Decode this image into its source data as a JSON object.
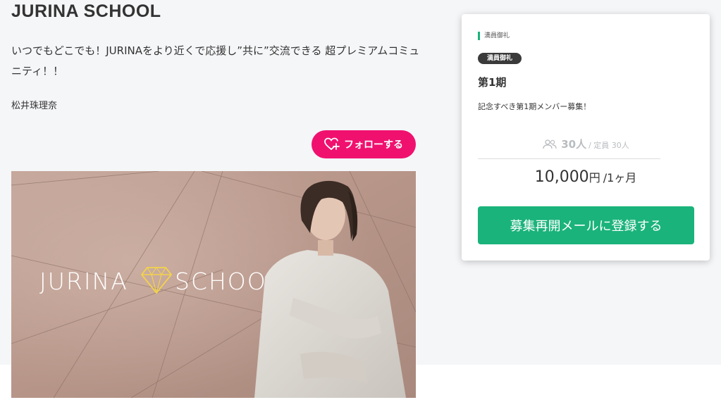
{
  "header": {
    "title": "JURINA SCHOOL",
    "description": "いつでもどこでも！JURINAをより近くで応援し”共に”交流できる 超プレミアムコミュニティ！！",
    "author": "松井珠理奈"
  },
  "follow": {
    "label": "フォローする",
    "icon": "heart-plus-icon"
  },
  "banner": {
    "logo_left": "JURINA",
    "logo_right": "SCHOOL",
    "logo_icon": "diamond-icon"
  },
  "plan": {
    "label": "満員御礼",
    "badge": "満員御礼",
    "period": "第1期",
    "description": "記念すべき第1期メンバー募集！",
    "member_count": "30人",
    "capacity": "/ 定員 30人",
    "price": "10,000",
    "currency": "円",
    "per": "/1ヶ月",
    "button": "募集再開メールに登録する"
  },
  "colors": {
    "follow": "#f0116f",
    "accent": "#1ab37b",
    "badge": "#3a3a3a",
    "page_bg": "#f5f6f8"
  }
}
